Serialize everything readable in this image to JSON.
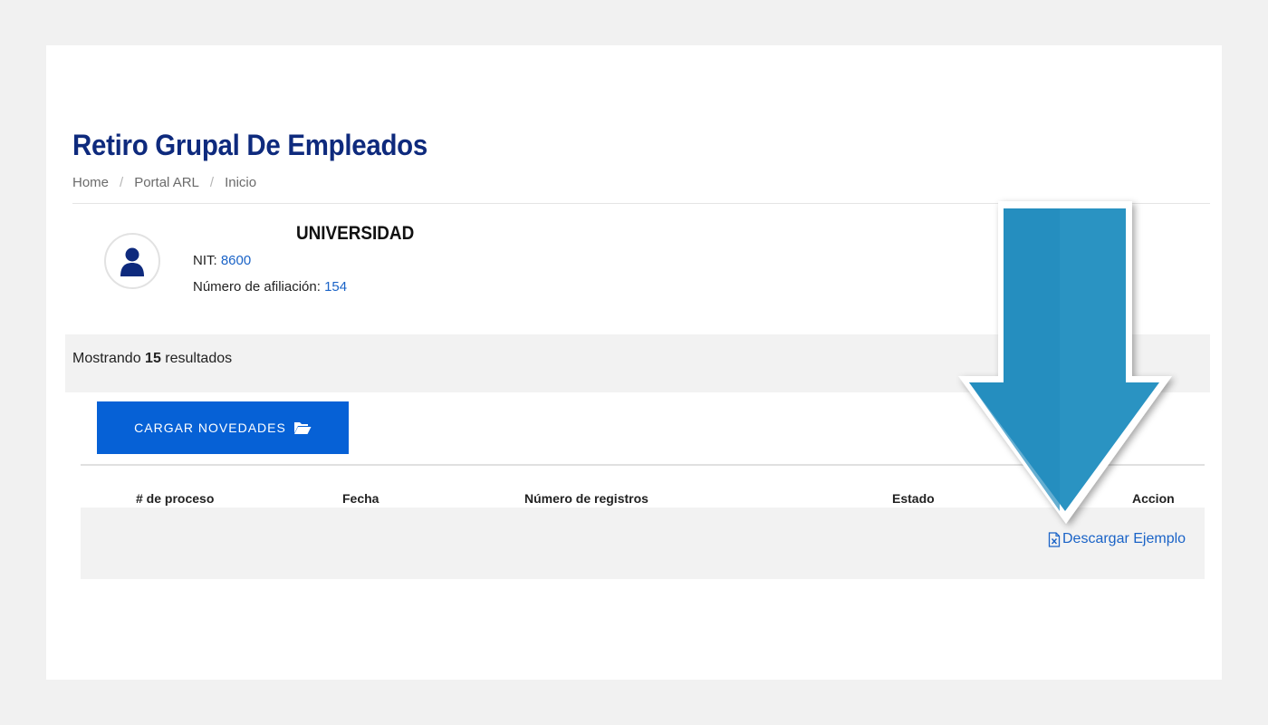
{
  "page": {
    "title": "Retiro Grupal De Empleados"
  },
  "breadcrumb": {
    "items": [
      "Home",
      "Portal ARL",
      "Inicio"
    ],
    "separator": "/"
  },
  "company": {
    "name": "UNIVERSIDAD",
    "nit_label": "NIT:",
    "nit_value": "8600",
    "afiliacion_label": "Número de afiliación:",
    "afiliacion_value": "154"
  },
  "results": {
    "prefix": "Mostrando",
    "count": "15",
    "suffix": "resultados"
  },
  "upload_button": {
    "label": "CARGAR NOVEDADES"
  },
  "table": {
    "columns": [
      "# de proceso",
      "Fecha",
      "Número de registros",
      "Estado",
      "Accion"
    ]
  },
  "download_link": {
    "label": "Descargar Ejemplo"
  },
  "icons": {
    "avatar": "user-icon",
    "upload": "folder-open-icon",
    "download": "excel-file-icon",
    "annotation": "arrow-down-icon"
  },
  "colors": {
    "title": "#0e2a7d",
    "primary_button": "#0661d6",
    "link": "#1a63c7",
    "arrow": "#2a93c2"
  }
}
